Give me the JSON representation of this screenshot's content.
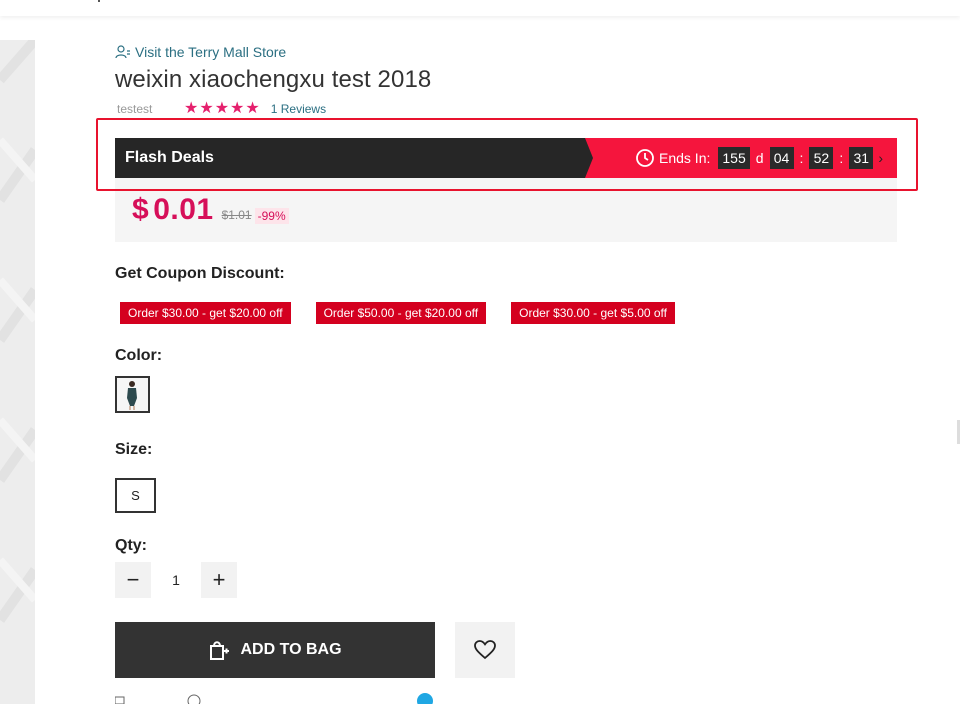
{
  "product": {
    "store_link": "Visit the Terry Mall Store",
    "title": "weixin xiaochengxu test 2018",
    "brand": "testest",
    "stars": "★★★★★",
    "reviews": "1 Reviews"
  },
  "flash_deal": {
    "title": "Flash Deals",
    "ends_in_label": "Ends In:",
    "days": "155",
    "days_unit": "d",
    "hours": "04",
    "minutes": "52",
    "seconds": "31",
    "separator": ":",
    "chevron": "›"
  },
  "price": {
    "currency": "$",
    "current": "0.01",
    "original": "$1.01",
    "discount": "-99%"
  },
  "coupons": {
    "label": "Get Coupon Discount:",
    "items": [
      "Order $30.00 - get $20.00 off",
      "Order $50.00 - get $20.00 off",
      "Order $30.00 - get $5.00 off"
    ]
  },
  "color": {
    "label": "Color:"
  },
  "size": {
    "label": "Size:",
    "selected": "S"
  },
  "qty": {
    "label": "Qty:",
    "value": "1",
    "minus": "−",
    "plus": "+"
  },
  "actions": {
    "add_to_bag": "ADD TO BAG"
  },
  "colors": {
    "accent": "#d60f59",
    "flash_red": "#f5153d",
    "coupon_red": "#d4001f",
    "link": "#2b6f82",
    "dark": "#333333"
  }
}
